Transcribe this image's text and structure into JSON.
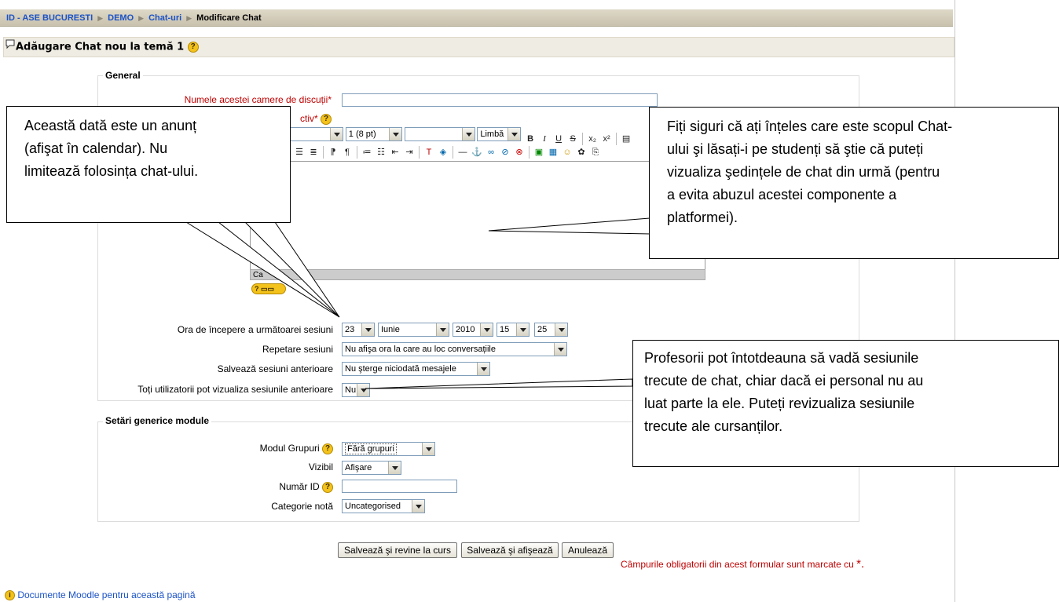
{
  "breadcrumb": {
    "items": [
      "ID - ASE BUCURESTI",
      "DEMO",
      "Chat-uri"
    ],
    "current": "Modificare Chat"
  },
  "heading": {
    "text": "Adăugare Chat nou la temă 1"
  },
  "general": {
    "legend": "General",
    "name_label": "Numele acestei camere de discuții",
    "required_mark": "*",
    "intro_label_partial": "ctiv",
    "editor_toolbar": {
      "font_partial": "t",
      "size": "1 (8 pt)",
      "heading": "",
      "lang": "Limbă"
    },
    "editor_status_partial": "Ca",
    "hint_button": "?"
  },
  "session": {
    "start_label": "Ora de începere a următoarei sesiuni",
    "start_values": [
      "23",
      "Iunie",
      "2010",
      "15",
      "25"
    ],
    "repeat_label": "Repetare sesiuni",
    "repeat_value": "Nu afişa ora la care au loc conversațiile",
    "save_label": "Salvează sesiuni anterioare",
    "save_value": "Nu şterge niciodată mesajele",
    "view_label": "Toți utilizatorii pot vizualiza sesiunile anterioare",
    "view_value": "Nu"
  },
  "module": {
    "legend": "Setări generice module",
    "group_label": "Modul Grupuri",
    "group_value": "Fără grupuri",
    "visible_label": "Vizibil",
    "visible_value": "Afişare",
    "id_label": "Număr ID",
    "grade_label": "Categorie notă",
    "grade_value": "Uncategorised"
  },
  "buttons": {
    "save_return": "Salvează şi revine la curs",
    "save_show": "Salvează şi afişează",
    "cancel": "Anulează"
  },
  "required_note": {
    "text": "Câmpurile obligatorii din acest formular sunt marcate cu",
    "star": "*."
  },
  "footer": {
    "docs_link": "Documente Moodle pentru această pagină"
  },
  "callouts": {
    "left": [
      "Această dată este un anunț",
      "(afişat în calendar). Nu",
      "limitează folosința chat-ului."
    ],
    "right": [
      "Fiți siguri că ați înțeles care este scopul Chat-",
      "ului şi lăsați-i pe studenți să ştie că puteți",
      "vizualiza şedințele de chat din urmă (pentru",
      "a evita abuzul acestei componente a",
      "platformei)."
    ],
    "bottom": [
      "Profesorii pot întotdeauna să vadă sesiunile",
      "trecute de chat, chiar dacă ei personal nu au",
      "luat parte la ele. Puteți revizualiza sesiunile",
      "trecute ale cursanților."
    ]
  }
}
